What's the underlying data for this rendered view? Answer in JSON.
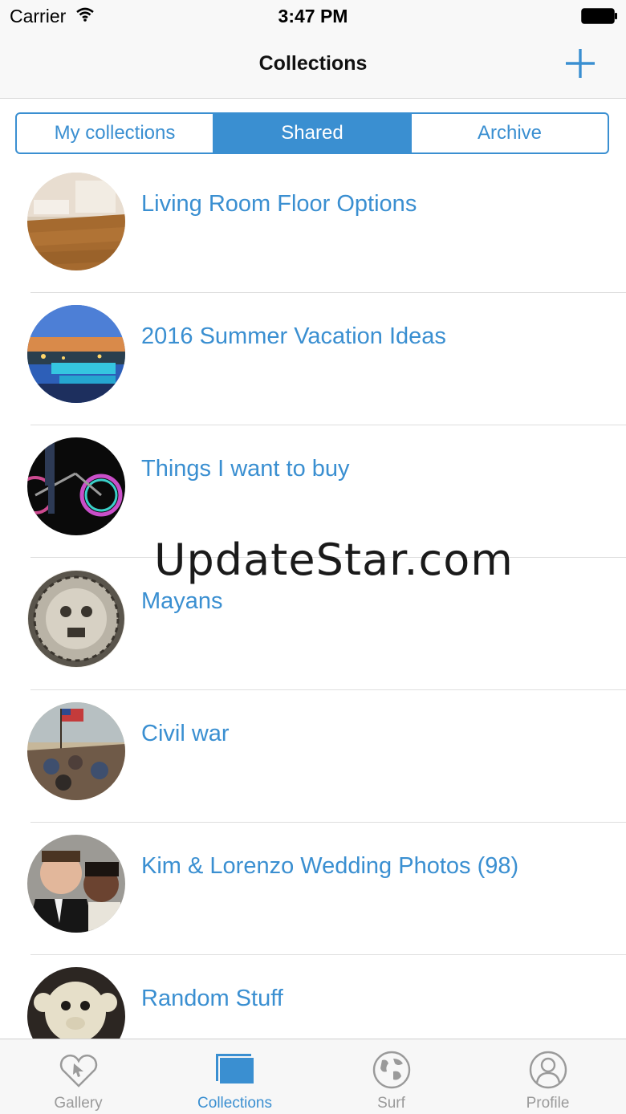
{
  "status": {
    "carrier": "Carrier",
    "time": "3:47 PM"
  },
  "nav": {
    "title": "Collections"
  },
  "segments": [
    {
      "label": "My collections",
      "active": false
    },
    {
      "label": "Shared",
      "active": true
    },
    {
      "label": "Archive",
      "active": false
    }
  ],
  "collections": [
    {
      "title": "Living Room Floor Options"
    },
    {
      "title": "2016 Summer Vacation Ideas"
    },
    {
      "title": "Things I want to buy"
    },
    {
      "title": "Mayans"
    },
    {
      "title": "Civil war"
    },
    {
      "title": "Kim & Lorenzo Wedding Photos (98)"
    },
    {
      "title": "Random Stuff"
    }
  ],
  "watermark": "UpdateStar.com",
  "tabs": [
    {
      "label": "Gallery",
      "icon": "heart-cursor-icon",
      "active": false
    },
    {
      "label": "Collections",
      "icon": "collections-icon",
      "active": true
    },
    {
      "label": "Surf",
      "icon": "globe-icon",
      "active": false
    },
    {
      "label": "Profile",
      "icon": "person-icon",
      "active": false
    }
  ],
  "colors": {
    "accent": "#3a8fd1",
    "inactive_tab": "#9a9a9a",
    "separator": "#dedede"
  }
}
